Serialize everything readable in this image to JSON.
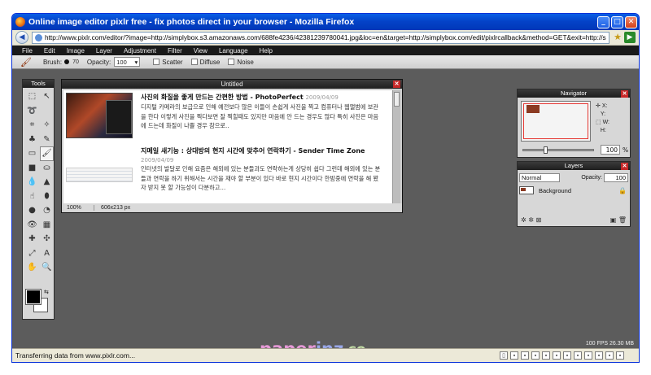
{
  "window": {
    "title": "Online image editor pixlr free - fix photos direct in your browser - Mozilla Firefox",
    "url": "http://www.pixlr.com/editor/?image=http://simplybox.s3.amazonaws.com/688fe4236/42381239780041.jpg&loc=en&target=http://simplybox.com/edit/pixlrcallback&method=GET&exit=http://simplybox.com/"
  },
  "menu": [
    "File",
    "Edit",
    "Image",
    "Layer",
    "Adjustment",
    "Filter",
    "View",
    "Language",
    "Help"
  ],
  "options": {
    "brush_label": "Brush:",
    "brush_size": "70",
    "opacity_label": "Opacity:",
    "opacity_value": "100",
    "scatter_label": "Scatter",
    "diffuse_label": "Diffuse",
    "noise_label": "Noise"
  },
  "tools_panel": {
    "title": "Tools"
  },
  "document": {
    "title": "Untitled",
    "zoom": "100%",
    "dimensions": "606x213 px",
    "posts": [
      {
        "title": "사진의 화질을 좋게 만드는 간편한 방법 - PhotoPerfect",
        "date": "2009/04/09",
        "body": "디지털 카메라의 보급으로 인해 예전보다 많은 이들이 손쉽게 사진을 찍고 컴퓨터나 웹앨범에 보관을 한다 이렇게 사진을 찍다보면 잘 찍힐때도 있지만 마음에 안 드는 경우도 많다 특히 사진은 마음에 드는데 화질이 나쁠 경우 참으로.."
      },
      {
        "title": "지메일 새기능 : 상대방의 현지 시간에 맞추어 연락하기 - Sender Time Zone",
        "date": "2009/04/09",
        "body": "인터넷의 발달로 인해 요즘은 해외에 있는 분들과도 연락하는게 상당히 쉽다 그런데 해외에 있는 분들과 연락을 하기 위해서는 시간을 재야 할 부분이 있다 바로 현지 시간이다 한밤중에 연락을 해 봤자 받지 못 할 가능성이 다분하고..."
      }
    ]
  },
  "navigator": {
    "title": "Navigator",
    "x_label": "X:",
    "y_label": "Y:",
    "w_label": "W:",
    "h_label": "H:",
    "zoom_value": "100",
    "zoom_unit": "%",
    "zoom_fraction": 0.3
  },
  "layers": {
    "title": "Layers",
    "blend_mode": "Normal",
    "opacity_label": "Opacity:",
    "opacity_value": "100",
    "items": [
      {
        "name": "Background"
      }
    ]
  },
  "fps": "100 FPS 26.30 MB",
  "watermark": {
    "part1": "paper",
    "part2": "inz",
    "part3": ".COm"
  },
  "status": "Transferring data from www.pixlr.com...",
  "colors": {
    "titlebar": "#0443c8",
    "app_bg": "#5c5c5c",
    "panel_bg": "#d7d7d7",
    "close_red": "#c62828"
  }
}
